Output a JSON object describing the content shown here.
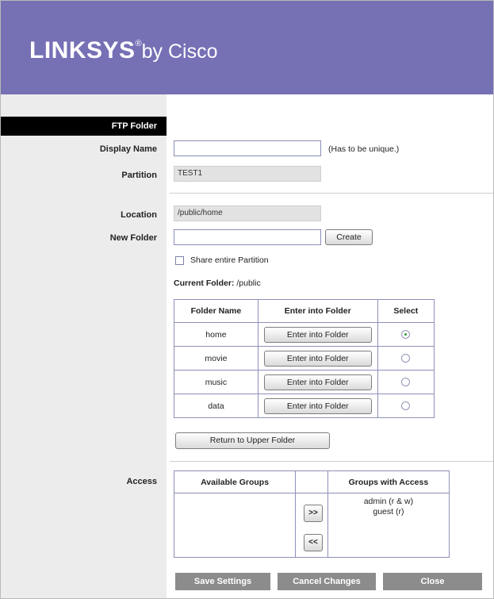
{
  "header": {
    "brand": "LINKSYS",
    "registered": "®",
    "byline": "by Cisco",
    "bg_color": "#7670b5"
  },
  "section": {
    "title": "FTP Folder"
  },
  "form": {
    "display_name": {
      "label": "Display Name",
      "value": "",
      "hint": "(Has to be unique.)"
    },
    "partition": {
      "label": "Partition",
      "value": "TEST1"
    },
    "location": {
      "label": "Location",
      "value": "/public/home"
    },
    "new_folder": {
      "label": "New Folder",
      "value": "",
      "create_label": "Create"
    },
    "share_entire": {
      "label": "Share entire Partition",
      "checked": false
    },
    "current_folder": {
      "label": "Current Folder:",
      "value": "/public"
    }
  },
  "folder_table": {
    "headers": [
      "Folder Name",
      "Enter into Folder",
      "Select"
    ],
    "rows": [
      {
        "name": "home",
        "button": "Enter into Folder",
        "selected": true
      },
      {
        "name": "movie",
        "button": "Enter into Folder",
        "selected": false
      },
      {
        "name": "music",
        "button": "Enter into Folder",
        "selected": false
      },
      {
        "name": "data",
        "button": "Enter into Folder",
        "selected": false
      }
    ]
  },
  "return_button": "Return to Upper Folder",
  "access": {
    "label": "Access",
    "available_header": "Available Groups",
    "with_access_header": "Groups with Access",
    "available": [],
    "with_access": [
      "admin (r & w)",
      "guest (r)"
    ],
    "add_label": ">>",
    "remove_label": "<<"
  },
  "footer": {
    "save": "Save Settings",
    "cancel": "Cancel Changes",
    "close": "Close"
  }
}
